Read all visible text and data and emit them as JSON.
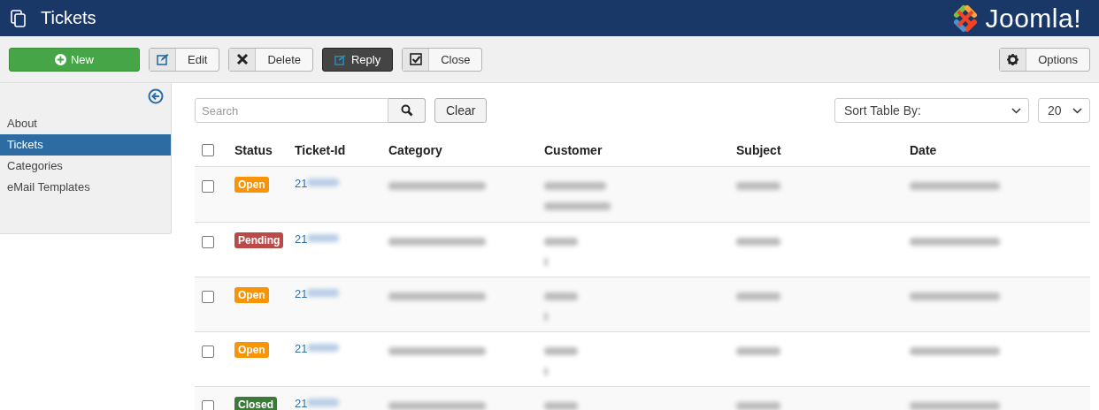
{
  "header": {
    "title": "Tickets",
    "brand": "Joomla!"
  },
  "toolbar": [
    {
      "kind": "primary",
      "label": "New"
    },
    {
      "kind": "split",
      "label": "Edit"
    },
    {
      "kind": "split",
      "label": "Delete"
    },
    {
      "kind": "dark",
      "label": "Reply"
    },
    {
      "kind": "split",
      "label": "Close"
    }
  ],
  "options_button": {
    "label": "Options"
  },
  "sidebar": {
    "items": [
      {
        "label": "About",
        "selected": false
      },
      {
        "label": "Tickets",
        "selected": true
      },
      {
        "label": "Categories",
        "selected": false
      },
      {
        "label": "eMail Templates",
        "selected": false
      }
    ]
  },
  "filters": {
    "search": {
      "placeholder": "Search"
    },
    "clear": "Clear",
    "sort": {
      "value": "Sort Table By:"
    },
    "limit": {
      "value": "20"
    }
  },
  "table": {
    "select_all": {
      "checked": false
    },
    "columns": [
      "Status",
      "Ticket-Id",
      "Category",
      "Customer",
      "Subject",
      "Date"
    ],
    "rows": [
      {
        "checked": false,
        "status": {
          "label": "Open",
          "color": "#f89406"
        },
        "ticket_id": "21"
      },
      {
        "checked": false,
        "status": {
          "label": "Pending",
          "color": "#b94a48"
        },
        "ticket_id": "21"
      },
      {
        "checked": false,
        "status": {
          "label": "Open",
          "color": "#f89406"
        },
        "ticket_id": "21"
      },
      {
        "checked": false,
        "status": {
          "label": "Open",
          "color": "#f89406"
        },
        "ticket_id": "21"
      },
      {
        "checked": false,
        "status": {
          "label": "Closed",
          "color": "#3b7a3b"
        },
        "ticket_id": "21"
      }
    ]
  }
}
